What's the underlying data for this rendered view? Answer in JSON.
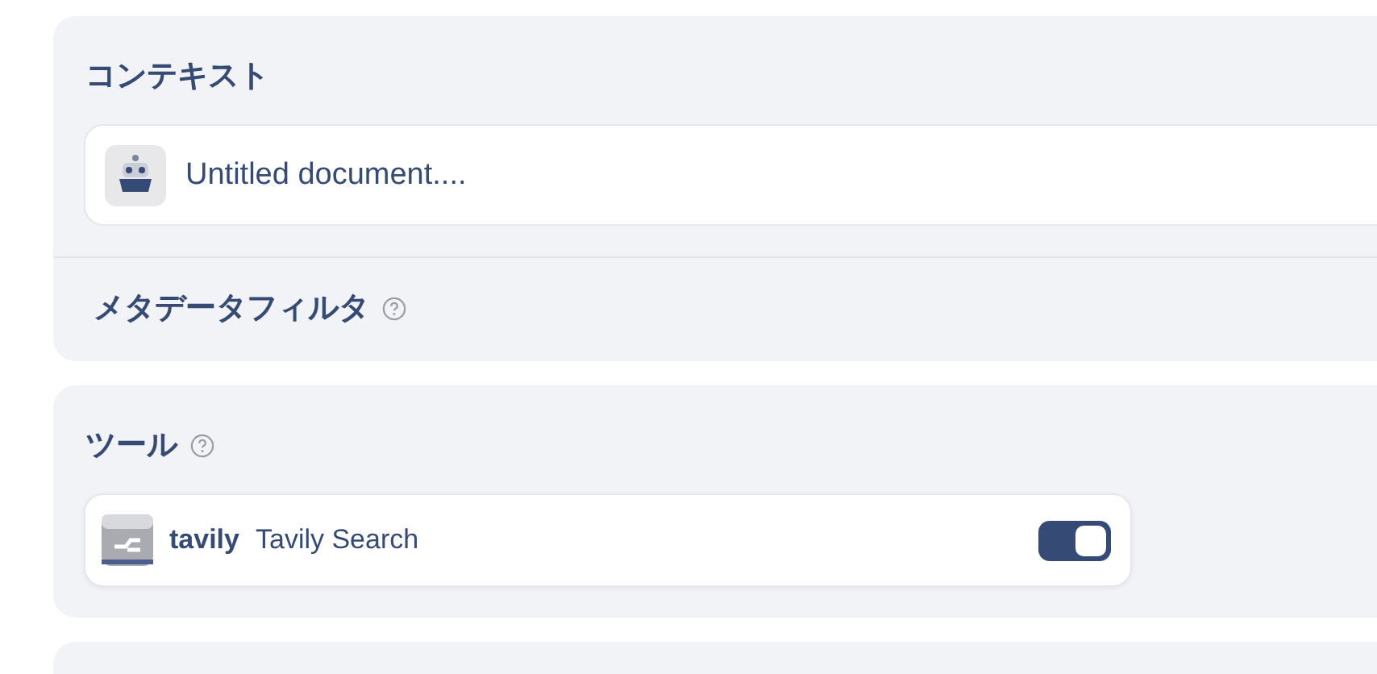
{
  "context": {
    "title": "コンテキスト",
    "document": {
      "name": "Untitled document...."
    },
    "filter": {
      "label": "メタデータフィルタ"
    }
  },
  "tools": {
    "title": "ツール",
    "items": [
      {
        "id_label": "tavily",
        "name": "Tavily Search",
        "on": true
      }
    ]
  }
}
